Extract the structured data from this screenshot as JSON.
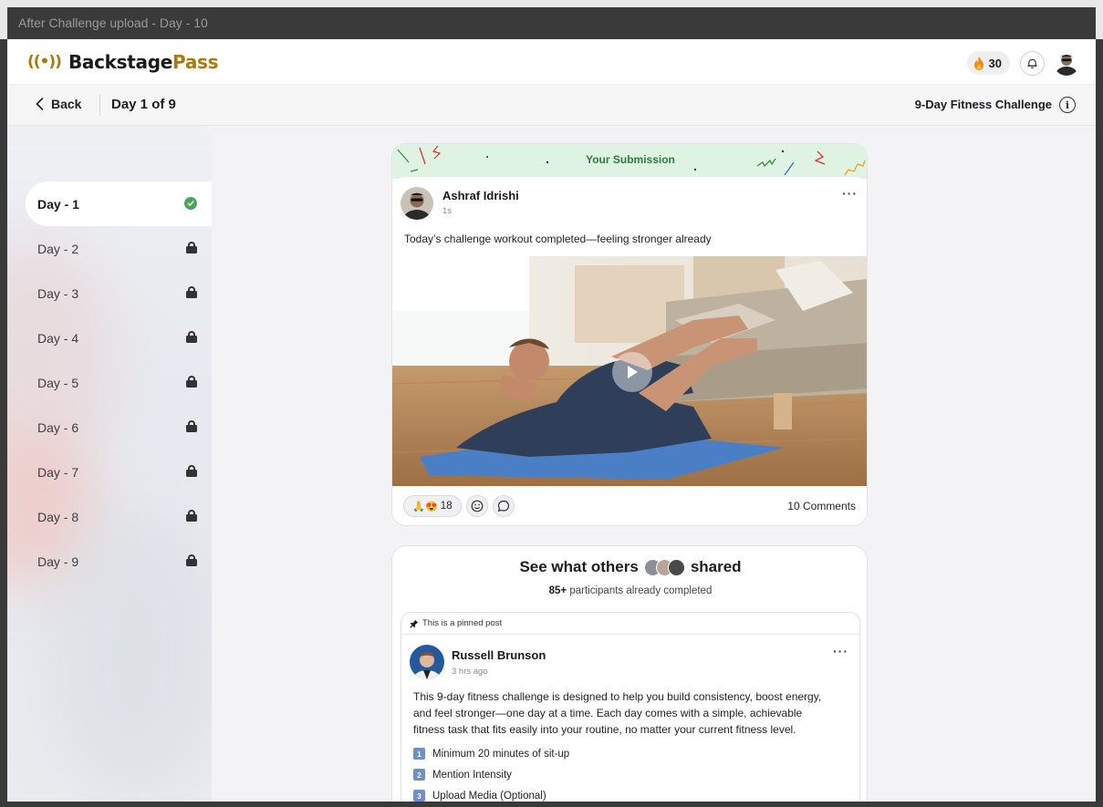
{
  "window": {
    "title": "After Challenge upload - Day - 10"
  },
  "brand": {
    "mark": "((•))",
    "name_part1": "Backstage",
    "name_part2": "Pass",
    "color": "#a8790b"
  },
  "header": {
    "streak_count": "30",
    "icons": [
      "flame-icon",
      "bell-icon",
      "avatar"
    ]
  },
  "subbar": {
    "back_label": "Back",
    "day_counter": "Day 1 of 9",
    "challenge_title": "9-Day Fitness Challenge",
    "info_glyph": "i"
  },
  "sidebar": {
    "items": [
      {
        "label": "Day - 1",
        "status": "completed"
      },
      {
        "label": "Day - 2",
        "status": "locked"
      },
      {
        "label": "Day - 3",
        "status": "locked"
      },
      {
        "label": "Day - 4",
        "status": "locked"
      },
      {
        "label": "Day - 5",
        "status": "locked"
      },
      {
        "label": "Day - 6",
        "status": "locked"
      },
      {
        "label": "Day - 7",
        "status": "locked"
      },
      {
        "label": "Day - 8",
        "status": "locked"
      },
      {
        "label": "Day - 9",
        "status": "locked"
      }
    ]
  },
  "submission": {
    "header_label": "Your Submission",
    "author": "Ashraf Idrishi",
    "time": "1s",
    "text": "Today’s challenge workout completed—feeling stronger already",
    "more": "···",
    "reaction_emojis": "🙏😍",
    "reaction_count": "18",
    "comments_label": "10 Comments"
  },
  "others": {
    "title_part1": "See what others",
    "title_part2": "shared",
    "count_bold": "85+",
    "count_rest": "participants already completed",
    "pinned_label": "This is a pinned post",
    "author": "Russell Brunson",
    "time": "3 hrs ago",
    "more": "···",
    "text_line1": "This 9-day fitness challenge is designed to help you build consistency, boost energy,",
    "text_line2": "and feel stronger—one day at a time. Each day comes with a simple, achievable",
    "text_line3": "fitness task that fits easily into your routine, no matter your current fitness level.",
    "rules": [
      {
        "num": "1",
        "text": "Minimum 20 minutes of sit-up"
      },
      {
        "num": "2",
        "text": "Mention Intensity"
      },
      {
        "num": "3",
        "text": "Upload Media (Optional)"
      }
    ]
  },
  "colors": {
    "accent_gold": "#a8790b",
    "success_green": "#4fa35e",
    "confetti_bg": "#dff3e3",
    "rule_badge": "#6e8fc7"
  }
}
